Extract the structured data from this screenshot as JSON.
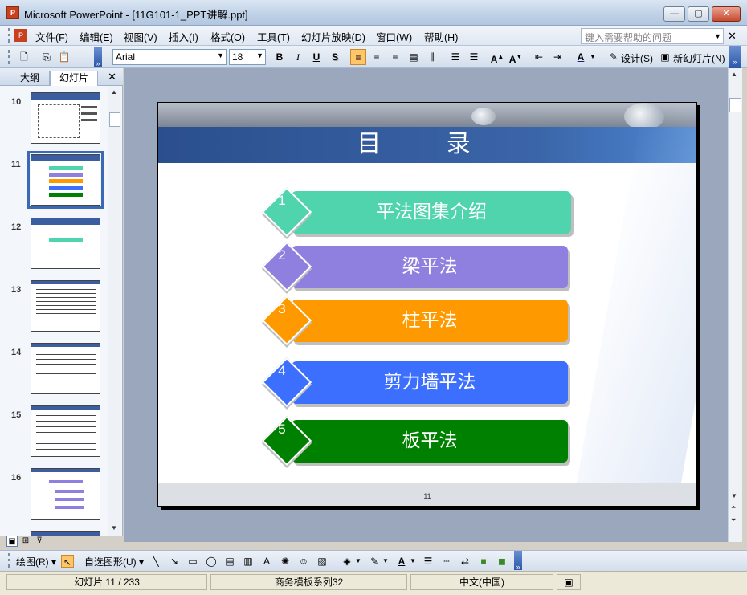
{
  "window": {
    "title": "Microsoft PowerPoint - [11G101-1_PPT讲解.ppt]",
    "app_icon": "ppt-app-icon",
    "controls": {
      "minimize": "—",
      "maximize": "▢",
      "close": "✕"
    }
  },
  "menu": {
    "items": [
      "文件(F)",
      "编辑(E)",
      "视图(V)",
      "插入(I)",
      "格式(O)",
      "工具(T)",
      "幻灯片放映(D)",
      "窗口(W)",
      "帮助(H)"
    ],
    "help_placeholder": "键入需要帮助的问题",
    "close_glyph": "✕"
  },
  "toolbar": {
    "font": "Arial",
    "size": "18",
    "bold": "B",
    "italic": "I",
    "underline": "U",
    "shadow": "S",
    "design_label": "设计(S)",
    "new_slide_label": "新幻灯片(N)"
  },
  "left_pane": {
    "tabs": [
      "大纲",
      "幻灯片"
    ],
    "active_tab": "幻灯片",
    "close_glyph": "✕",
    "slides": [
      {
        "number": "10"
      },
      {
        "number": "11",
        "selected": true
      },
      {
        "number": "12"
      },
      {
        "number": "13"
      },
      {
        "number": "14"
      },
      {
        "number": "15"
      },
      {
        "number": "16"
      }
    ]
  },
  "slide": {
    "title": "目 录",
    "page_number": "11",
    "items": [
      {
        "num": "1",
        "label": "平法图集介绍",
        "color": "#4fd4ad"
      },
      {
        "num": "2",
        "label": "梁平法",
        "color": "#8f7fdf"
      },
      {
        "num": "3",
        "label": "柱平法",
        "color": "#ff9900"
      },
      {
        "num": "4",
        "label": "剪力墙平法",
        "color": "#3d6fff"
      },
      {
        "num": "5",
        "label": "板平法",
        "color": "#008000"
      }
    ]
  },
  "drawbar": {
    "draw_label": "绘图(R)",
    "autoshapes_label": "自选图形(U)"
  },
  "status": {
    "slide_position": "幻灯片 11 / 233",
    "template": "商务模板系列32",
    "language": "中文(中国)"
  }
}
